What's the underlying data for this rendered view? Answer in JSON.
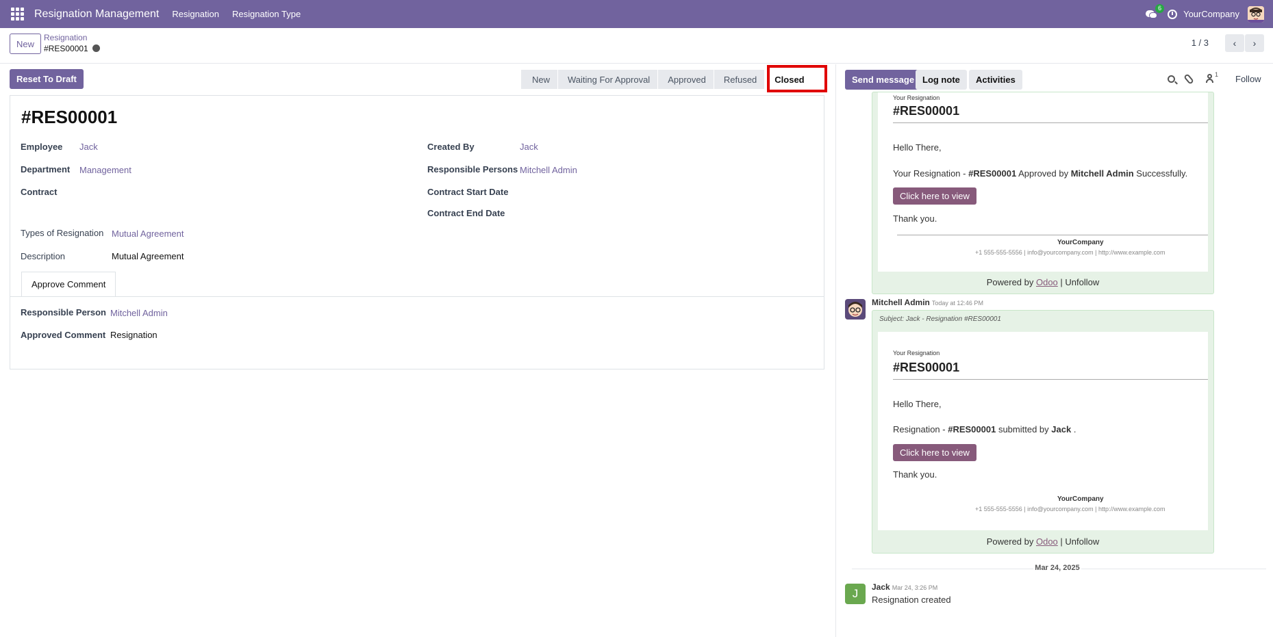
{
  "topbar": {
    "app_name": "Resignation Management",
    "nav": [
      "Resignation",
      "Resignation Type"
    ],
    "chat_badge": "6",
    "company": "YourCompany",
    "accent": "#71639e"
  },
  "control_panel": {
    "new_label": "New",
    "breadcrumb_parent": "Resignation",
    "breadcrumb_current": "#RES00001",
    "pager": "1 / 3"
  },
  "statusbar": {
    "reset_label": "Reset To Draft",
    "stages": [
      "New",
      "Waiting For Approval",
      "Approved",
      "Refused",
      "Closed"
    ],
    "active_stage": "Closed"
  },
  "form": {
    "reference": "#RES00001",
    "employee_label": "Employee",
    "employee_value": "Jack",
    "department_label": "Department",
    "department_value": "Management",
    "contract_label": "Contract",
    "created_by_label": "Created By",
    "created_by_value": "Jack",
    "responsible_persons_label": "Responsible Persons",
    "responsible_persons_value": "Mitchell Admin",
    "contract_start_label": "Contract Start Date",
    "contract_end_label": "Contract End Date",
    "types_label": "Types of Resignation",
    "types_value": "Mutual Agreement",
    "description_label": "Description",
    "description_value": "Mutual Agreement",
    "tab_label": "Approve Comment",
    "responsible_person_label": "Responsible Person",
    "responsible_person_value": "Mitchell Admin",
    "approved_comment_label": "Approved Comment",
    "approved_comment_value": "Resignation"
  },
  "chatter": {
    "send_message": "Send message",
    "log_note": "Log note",
    "activities": "Activities",
    "follower_count": "1",
    "follow": "Follow",
    "mail1": {
      "small": "Your Resignation",
      "ref": "#RES00001",
      "greeting": "Hello There,",
      "body_pre": "Your Resignation - ",
      "body_ref": "#RES00001",
      "body_mid": " Approved by ",
      "body_name": "Mitchell Admin",
      "body_post": " Successfully.",
      "button": "Click here to view",
      "thanks": "Thank you.",
      "company": "YourCompany",
      "contact": "+1 555-555-5556 | info@yourcompany.com | http://www.example.com",
      "powered_pre": "Powered by ",
      "powered_link": "Odoo",
      "powered_post": " | Unfollow"
    },
    "msg2": {
      "author": "Mitchell Admin",
      "date": "Today at 12:46 PM",
      "subject": "Subject: Jack - Resignation #RES00001",
      "small": "Your Resignation",
      "ref": "#RES00001",
      "greeting": "Hello There,",
      "body_pre": "Resignation - ",
      "body_ref": "#RES00001",
      "body_mid": " submitted by ",
      "body_name": "Jack",
      "body_post": " .",
      "button": "Click here to view",
      "thanks": "Thank you.",
      "company": "YourCompany",
      "contact": "+1 555-555-5556 | info@yourcompany.com | http://www.example.com",
      "powered_pre": "Powered by ",
      "powered_link": "Odoo",
      "powered_post": " | Unfollow"
    },
    "date_separator": "Mar 24, 2025",
    "msg3": {
      "avatar_letter": "J",
      "author": "Jack",
      "date": "Mar 24, 3:26 PM",
      "body": "Resignation created"
    }
  }
}
